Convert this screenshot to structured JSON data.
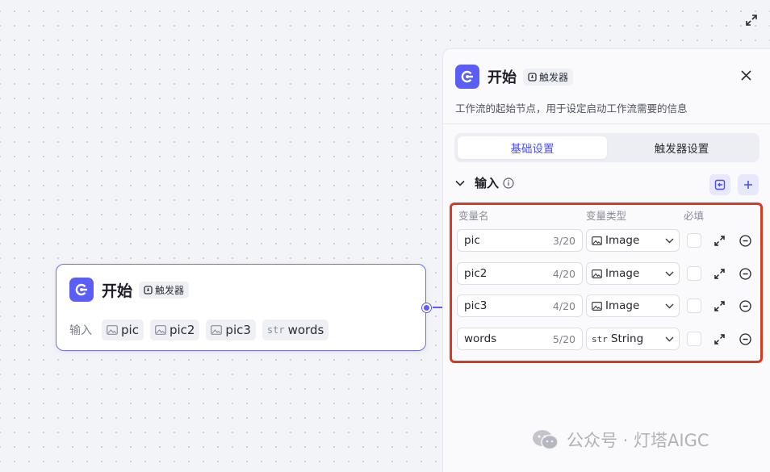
{
  "node": {
    "title": "开始",
    "badge": "触发器",
    "inputs_label": "输入",
    "chips": [
      {
        "type_icon": "image-icon",
        "label": "pic"
      },
      {
        "type_icon": "image-icon",
        "label": "pic2"
      },
      {
        "type_icon": "image-icon",
        "label": "pic3"
      },
      {
        "type_icon": "str",
        "label": "words"
      }
    ]
  },
  "panel": {
    "title": "开始",
    "badge": "触发器",
    "description": "工作流的起始节点，用于设定启动工作流需要的信息",
    "tabs": [
      {
        "label": "基础设置",
        "active": true
      },
      {
        "label": "触发器设置",
        "active": false
      }
    ],
    "section_title": "输入",
    "columns": {
      "name": "变量名",
      "type": "变量类型",
      "required": "必填"
    },
    "rows": [
      {
        "name": "pic",
        "count": "3/20",
        "type_icon": "image-icon",
        "type": "Image"
      },
      {
        "name": "pic2",
        "count": "4/20",
        "type_icon": "image-icon",
        "type": "Image"
      },
      {
        "name": "pic3",
        "count": "4/20",
        "type_icon": "image-icon",
        "type": "Image"
      },
      {
        "name": "words",
        "count": "5/20",
        "type_icon": "str",
        "type": "String"
      }
    ]
  },
  "watermark": {
    "text": "公众号 · 灯塔AIGC"
  },
  "colors": {
    "accent": "#5b5ef5",
    "highlight": "#d63a1f"
  }
}
